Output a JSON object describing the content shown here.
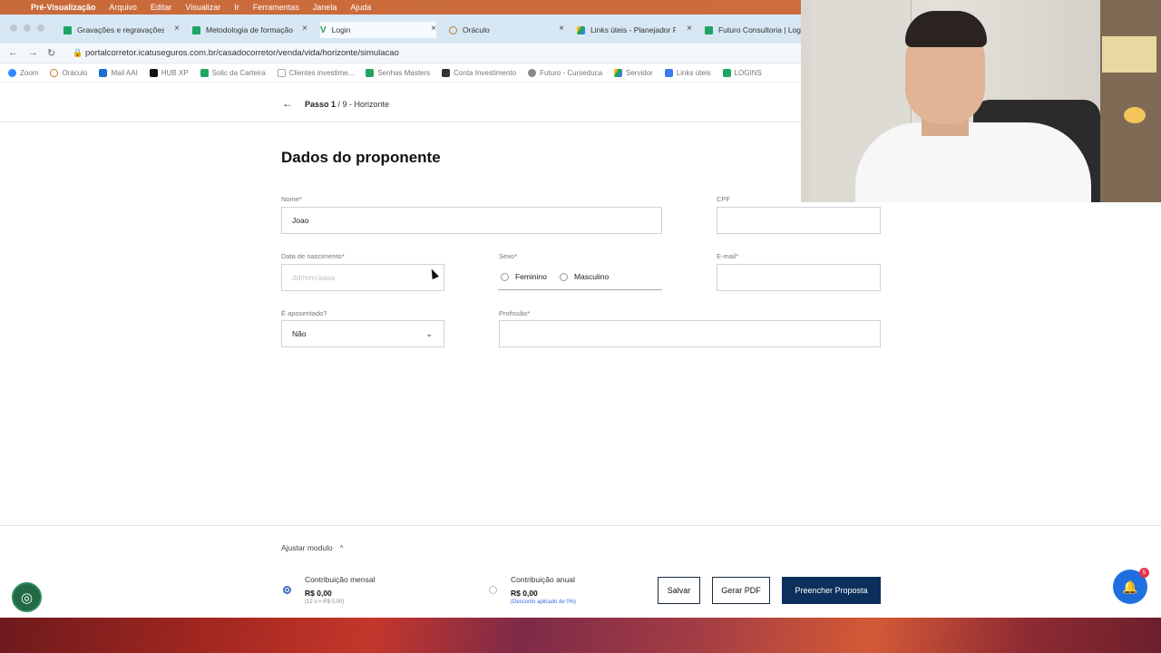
{
  "menubar": {
    "app": "Pré-Visualização",
    "items": [
      "Arquivo",
      "Editar",
      "Visualizar",
      "Ir",
      "Ferramentas",
      "Janela",
      "Ajuda"
    ]
  },
  "tabs": [
    {
      "label": "Gravações e regravações",
      "icon": "sheets-icon"
    },
    {
      "label": "Metodologia de formação",
      "icon": "sheets-icon"
    },
    {
      "label": "Login",
      "icon": "v-logo-icon"
    },
    {
      "label": "Oráculo",
      "icon": "globe-icon"
    },
    {
      "label": "Links úteis - Planejador F",
      "icon": "drive-icon"
    },
    {
      "label": "Futuro Consultoria | Log",
      "icon": "sheets-icon"
    }
  ],
  "browser": {
    "url": "portalcorretor.icatuseguros.com.br/casadocorretor/venda/vida/horizonte/simulacao"
  },
  "bookmarks": [
    "Zoom",
    "Oráculo",
    "Mail AAI",
    "HUB XP",
    "Solic da Carteira",
    "Clientes investime...",
    "Senhas Masters",
    "Conta Investimento",
    "Futuro - Curseduca",
    "Servidor",
    "Links úteis",
    "LOGINS"
  ],
  "header": {
    "step": "Passo 1",
    "step_rest": " / 9 - Horizonte"
  },
  "form": {
    "title": "Dados do proponente",
    "nome_label": "Nome*",
    "nome_value": "Joao",
    "cpf_label": "CPF",
    "nascimento_label": "Data de nascimento*",
    "nascimento_placeholder": "dd/mm/aaaa",
    "sexo_label": "Sexo*",
    "sexo_options": [
      "Feminino",
      "Masculino"
    ],
    "email_label": "E-mail*",
    "aposentado_label": "É aposentado?",
    "aposentado_value": "Não",
    "profissao_label": "Profissão*"
  },
  "footer": {
    "ajustar": "Ajustar modulo",
    "mensal_label": "Contribuição mensal",
    "mensal_value": "R$ 0,00",
    "mensal_note": "(12 x = R$ 0,00)",
    "anual_label": "Contribuição anual",
    "anual_value": "R$ 0,00",
    "anual_note": "(Desconto aplicado de 0%)",
    "salvar": "Salvar",
    "gerar_pdf": "Gerar PDF",
    "preencher": "Preencher Proposta",
    "notif_count": "5"
  },
  "colors": {
    "primary_button": "#0d2f5c",
    "fab": "#1f6fe0",
    "cookie": "#216a45"
  }
}
